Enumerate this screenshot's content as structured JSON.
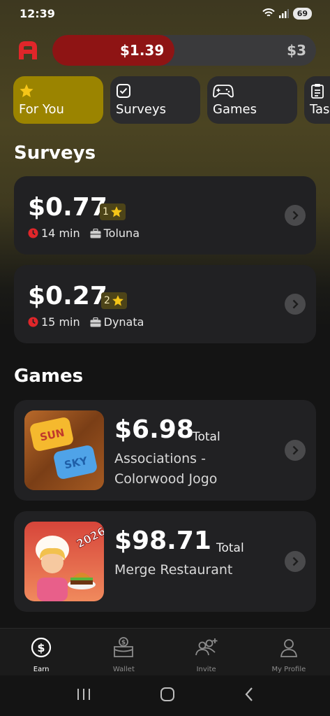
{
  "status_bar": {
    "time": "12:39",
    "battery": "69"
  },
  "progress": {
    "current": "$1.39",
    "goal": "$3",
    "fraction": 0.463
  },
  "tabs": [
    {
      "label": "For You",
      "icon": "star-icon",
      "active": true
    },
    {
      "label": "Surveys",
      "icon": "checkbox-icon"
    },
    {
      "label": "Games",
      "icon": "gamepad-icon"
    },
    {
      "label": "Tas",
      "icon": "clipboard-icon"
    }
  ],
  "surveys": {
    "title": "Surveys",
    "items": [
      {
        "amount": "$0.77",
        "level": "1",
        "time": "14 min",
        "provider": "Toluna"
      },
      {
        "amount": "$0.27",
        "level": "2",
        "time": "15 min",
        "provider": "Dynata"
      }
    ]
  },
  "games": {
    "title": "Games",
    "items": [
      {
        "amount": "$6.98",
        "total_label": "Total",
        "name_line1": "Associations -",
        "name_line2": "Colorwood Jogo",
        "thumb_text_1": "SUN",
        "thumb_text_2": "SKY"
      },
      {
        "amount": "$98.71",
        "total_label": "Total",
        "name_line1": "Merge Restaurant",
        "thumb_text_1": "2026"
      }
    ]
  },
  "bottom_nav": [
    {
      "label": "Earn",
      "icon": "dollar-coin-icon",
      "active": true
    },
    {
      "label": "Wallet",
      "icon": "wallet-icon"
    },
    {
      "label": "Invite",
      "icon": "invite-users-icon"
    },
    {
      "label": "My Profile",
      "icon": "profile-icon"
    }
  ],
  "colors": {
    "accent_gold": "#9b8400",
    "progress_red": "#8e1414",
    "card": "#212123",
    "star": "#f5c518"
  }
}
